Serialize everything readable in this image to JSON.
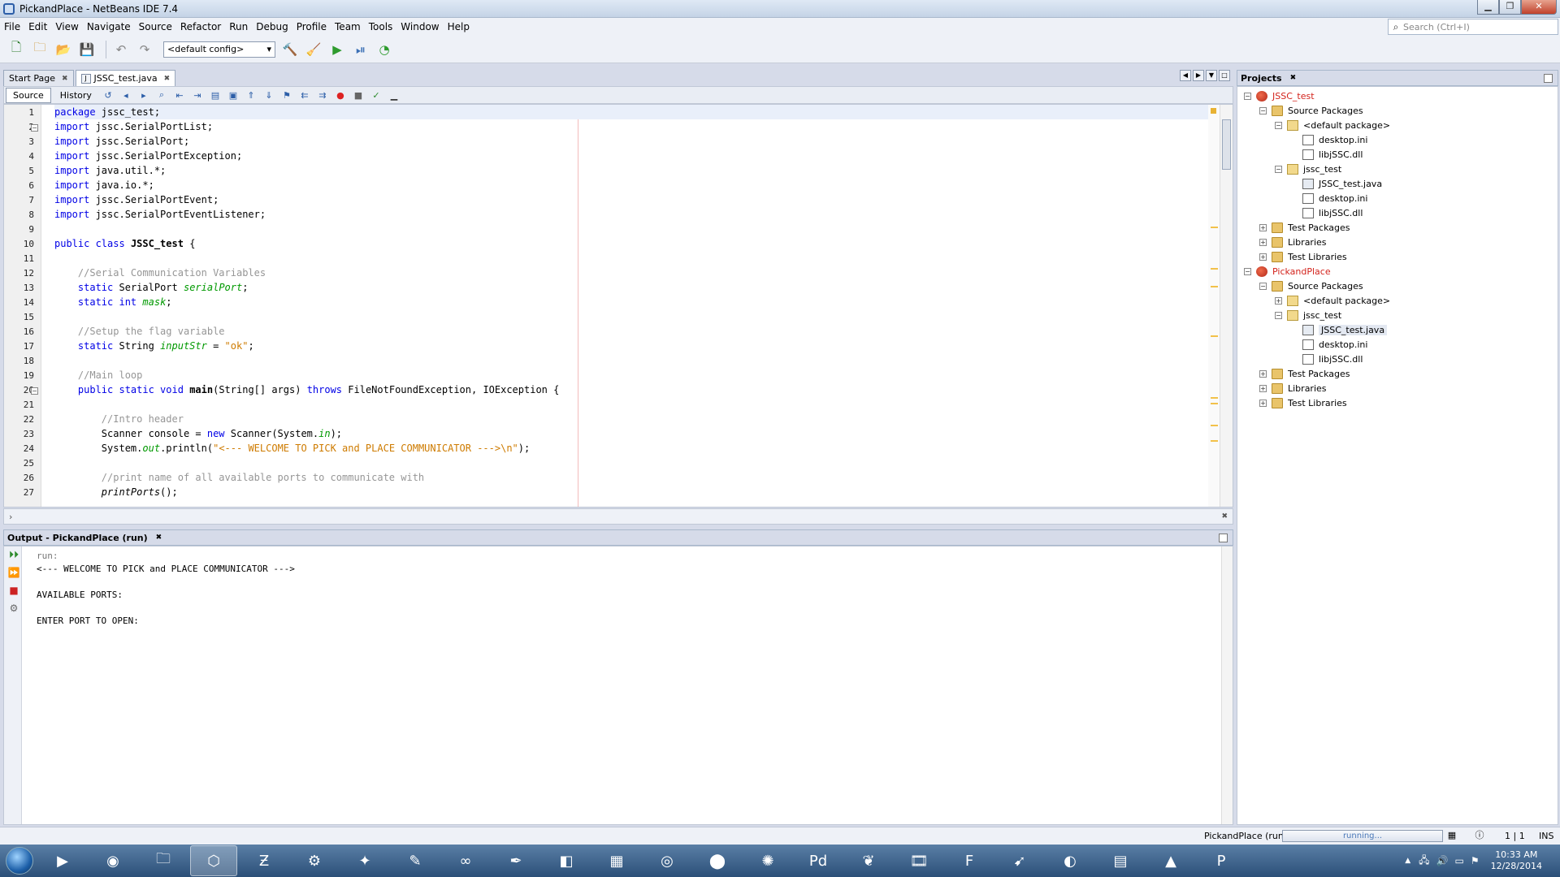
{
  "window": {
    "title": "PickandPlace - NetBeans IDE 7.4"
  },
  "menu": [
    "File",
    "Edit",
    "View",
    "Navigate",
    "Source",
    "Refactor",
    "Run",
    "Debug",
    "Profile",
    "Team",
    "Tools",
    "Window",
    "Help"
  ],
  "search": {
    "placeholder": "Search (Ctrl+I)"
  },
  "toolbar": {
    "config": "<default config>"
  },
  "editor_tabs": [
    {
      "label": "Start Page"
    },
    {
      "label": "JSSC_test.java"
    }
  ],
  "editor_toolbar": {
    "source": "Source",
    "history": "History"
  },
  "code_lines": [
    "package jssc_test;",
    "import jssc.SerialPortList;",
    "import jssc.SerialPort;",
    "import jssc.SerialPortException;",
    "import java.util.*;",
    "import java.io.*;",
    "import jssc.SerialPortEvent;",
    "import jssc.SerialPortEventListener;",
    "",
    "public class JSSC_test {",
    "",
    "    //Serial Communication Variables",
    "    static SerialPort serialPort;",
    "    static int mask;",
    "",
    "    //Setup the flag variable",
    "    static String inputStr = \"ok\";",
    "",
    "    //Main loop",
    "    public static void main(String[] args) throws FileNotFoundException, IOException {",
    "",
    "        //Intro header",
    "        Scanner console = new Scanner(System.in);",
    "        System.out.println(\"<--- WELCOME TO PICK and PLACE COMMUNICATOR --->\\n\");",
    "",
    "        //print name of all available ports to communicate with",
    "        printPorts();"
  ],
  "output": {
    "title": "Output - PickandPlace (run)",
    "lines": [
      "run:",
      "<--- WELCOME TO PICK and PLACE COMMUNICATOR --->",
      "",
      "AVAILABLE PORTS:",
      "",
      "ENTER PORT TO OPEN:"
    ]
  },
  "projects": {
    "title": "Projects",
    "tree": [
      {
        "label": "JSSC_test",
        "depth": 0,
        "icon": "project",
        "toggle": "-",
        "red": true
      },
      {
        "label": "Source Packages",
        "depth": 1,
        "icon": "folder",
        "toggle": "-"
      },
      {
        "label": "<default package>",
        "depth": 2,
        "icon": "package",
        "toggle": "-"
      },
      {
        "label": "desktop.ini",
        "depth": 3,
        "icon": "file",
        "toggle": ""
      },
      {
        "label": "libjSSC.dll",
        "depth": 3,
        "icon": "file",
        "toggle": ""
      },
      {
        "label": "jssc_test",
        "depth": 2,
        "icon": "package",
        "toggle": "-"
      },
      {
        "label": "JSSC_test.java",
        "depth": 3,
        "icon": "java",
        "toggle": ""
      },
      {
        "label": "desktop.ini",
        "depth": 3,
        "icon": "file",
        "toggle": ""
      },
      {
        "label": "libjSSC.dll",
        "depth": 3,
        "icon": "file",
        "toggle": ""
      },
      {
        "label": "Test Packages",
        "depth": 1,
        "icon": "folder",
        "toggle": "+"
      },
      {
        "label": "Libraries",
        "depth": 1,
        "icon": "folder",
        "toggle": "+"
      },
      {
        "label": "Test Libraries",
        "depth": 1,
        "icon": "folder",
        "toggle": "+"
      },
      {
        "label": "PickandPlace",
        "depth": 0,
        "icon": "project",
        "toggle": "-",
        "red": true
      },
      {
        "label": "Source Packages",
        "depth": 1,
        "icon": "folder",
        "toggle": "-"
      },
      {
        "label": "<default package>",
        "depth": 2,
        "icon": "package",
        "toggle": "+"
      },
      {
        "label": "jssc_test",
        "depth": 2,
        "icon": "package",
        "toggle": "-"
      },
      {
        "label": "JSSC_test.java",
        "depth": 3,
        "icon": "java",
        "toggle": "",
        "selected": true
      },
      {
        "label": "desktop.ini",
        "depth": 3,
        "icon": "file",
        "toggle": ""
      },
      {
        "label": "libjSSC.dll",
        "depth": 3,
        "icon": "file",
        "toggle": ""
      },
      {
        "label": "Test Packages",
        "depth": 1,
        "icon": "folder",
        "toggle": "+"
      },
      {
        "label": "Libraries",
        "depth": 1,
        "icon": "folder",
        "toggle": "+"
      },
      {
        "label": "Test Libraries",
        "depth": 1,
        "icon": "folder",
        "toggle": "+"
      }
    ]
  },
  "status": {
    "run_label": "PickandPlace (run)",
    "progress": "running...",
    "position": "1 | 1",
    "mode": "INS"
  },
  "taskbar": {
    "clock_time": "10:33 AM",
    "clock_date": "12/28/2014",
    "apps": [
      "media-player-icon",
      "firefox-icon",
      "file-explorer-icon",
      "netbeans-icon",
      "filezilla-icon",
      "steam-icon",
      "bird-app-icon",
      "sketch-app-icon",
      "arduino-icon",
      "pen-app-icon",
      "sketchup-icon",
      "map-app-icon",
      "eye-app-icon",
      "pin-app-icon",
      "molecule-app-icon",
      "pd-app-icon",
      "leaf-app-icon",
      "film-app-icon",
      "fusion-app-icon",
      "parrot-app-icon",
      "swirl-app-icon",
      "scanner-app-icon",
      "matlab-icon",
      "pocket-app-icon"
    ]
  }
}
